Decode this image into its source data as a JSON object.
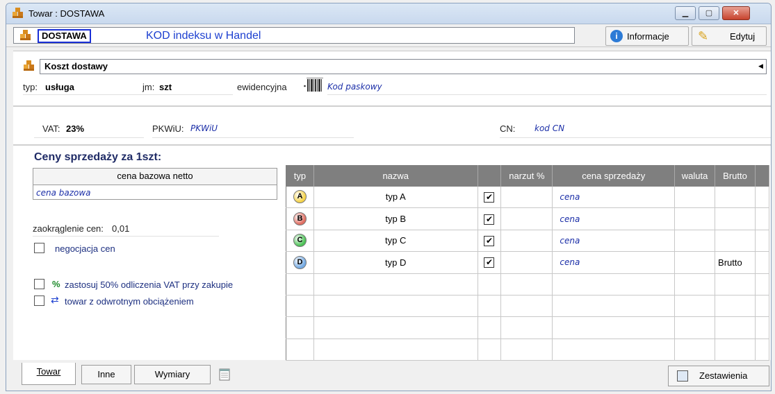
{
  "window": {
    "title": "Towar : DOSTAWA",
    "controls": [
      "minimize",
      "maximize",
      "close"
    ]
  },
  "header": {
    "code": "DOSTAWA",
    "code_label": "KOD indeksu w Handel",
    "info_button": "Informacje",
    "edit_button": "Edytuj"
  },
  "product": {
    "name": "Koszt dostawy",
    "typ_label": "typ:",
    "typ_value": "usługa",
    "jm_label": "jm:",
    "jm_value": "szt",
    "ewidencyjna_label": "ewidencyjna",
    "barcode_text": "Kod paskowy",
    "vat_label": "VAT:",
    "vat_value": "23%",
    "pkwiu_label": "PKWiU:",
    "pkwiu_value": "PKWiU",
    "cn_label": "CN:",
    "cn_value": "kod CN"
  },
  "prices": {
    "heading": "Ceny sprzedaży za 1szt:",
    "base_header": "cena bazowa netto",
    "base_value": "cena bazowa",
    "rounding_label": "zaokrąglenie cen:",
    "rounding_value": "0,01",
    "negotiation_label": "negocjacja cen",
    "vat50_label": "zastosuj 50% odliczenia VAT przy zakupie",
    "reverse_label": "towar z odwrotnym obciążeniem"
  },
  "price_table": {
    "headers": [
      "typ",
      "nazwa",
      "",
      "narzut %",
      "cena sprzedaży",
      "waluta",
      "Brutto",
      ""
    ],
    "rows": [
      {
        "badge": "A",
        "color": "#f5d34a",
        "name": "typ A",
        "checked": true,
        "price": "cena",
        "brutto": ""
      },
      {
        "badge": "B",
        "color": "#e06e62",
        "name": "typ B",
        "checked": true,
        "price": "cena",
        "brutto": ""
      },
      {
        "badge": "C",
        "color": "#4cc256",
        "name": "typ C",
        "checked": true,
        "price": "cena",
        "brutto": ""
      },
      {
        "badge": "D",
        "color": "#74a9e2",
        "name": "typ D",
        "checked": true,
        "price": "cena",
        "brutto": "Brutto"
      }
    ]
  },
  "tabs": [
    "Towar",
    "Inne",
    "Wymiary"
  ],
  "summary_button": "Zestawienia"
}
